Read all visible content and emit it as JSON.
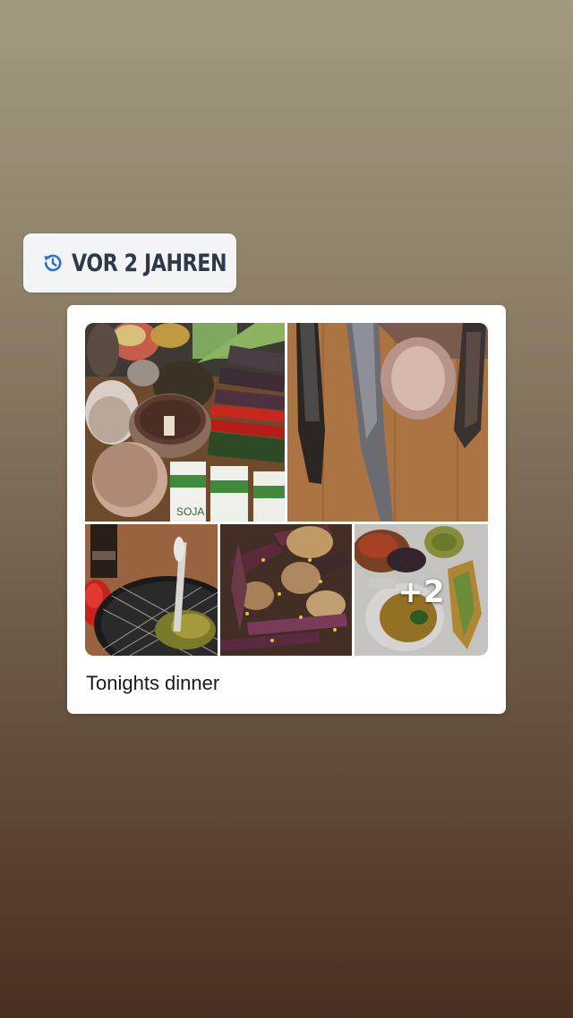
{
  "memory_badge": {
    "icon": "history-icon",
    "label": "VOR 2 JAHREN",
    "accent_color": "#2f6fd0"
  },
  "post": {
    "photos": [
      {
        "name": "vegetables-photo"
      },
      {
        "name": "purple-carrots-photo"
      },
      {
        "name": "plate-photo"
      },
      {
        "name": "roasted-vegetables-photo"
      },
      {
        "name": "served-dish-photo"
      }
    ],
    "more_photos_count": "+2",
    "caption": "Tonights dinner"
  }
}
